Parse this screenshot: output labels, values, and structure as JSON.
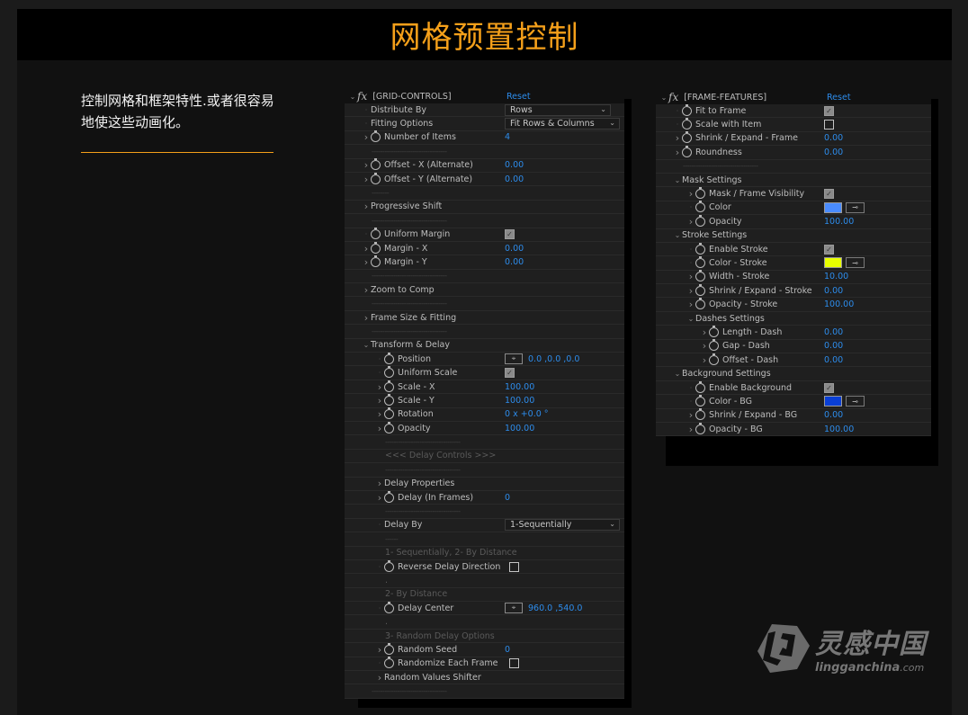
{
  "page": {
    "title": "网格预置控制",
    "description": "控制网格和框架特性.或者很容易地使这些动画化。"
  },
  "colors": {
    "accent": "#f5a01a",
    "value_blue": "#2d8ceb",
    "mask_color": "#4a8cff",
    "stroke_color": "#e8ff00",
    "bg_color": "#0a3fd6"
  },
  "grid_panel": {
    "title": "[GRID-CONTROLS]",
    "reset_label": "Reset",
    "rows": [
      {
        "type": "dropdown",
        "label": "Distribute By",
        "value": "Rows",
        "expander": "none",
        "stopwatch": false,
        "indent": 0
      },
      {
        "type": "dropdown",
        "label": "Fitting Options",
        "value": "Fit Rows & Columns",
        "expander": "none",
        "stopwatch": false,
        "indent": 0
      },
      {
        "type": "value",
        "label": "Number of Items",
        "value": "4",
        "expander": "collapsed",
        "stopwatch": true,
        "indent": 0
      },
      {
        "type": "separator",
        "label": "-----------------------------------",
        "indent": 0
      },
      {
        "type": "value",
        "label": "Offset - X (Alternate)",
        "value": "0.00",
        "expander": "collapsed",
        "stopwatch": true,
        "indent": 0
      },
      {
        "type": "value",
        "label": "Offset - Y (Alternate)",
        "value": "0.00",
        "expander": "collapsed",
        "stopwatch": true,
        "indent": 0
      },
      {
        "type": "separator",
        "label": "--------",
        "indent": 0
      },
      {
        "type": "group",
        "label": "Progressive Shift",
        "expander": "collapsed",
        "indent": 0
      },
      {
        "type": "separator",
        "label": "-----------------------------------",
        "indent": 0
      },
      {
        "type": "checkbox",
        "label": "Uniform Margin",
        "checked": true,
        "expander": "none",
        "stopwatch": true,
        "indent": 0
      },
      {
        "type": "value",
        "label": "Margin - X",
        "value": "0.00",
        "expander": "collapsed",
        "stopwatch": true,
        "indent": 0
      },
      {
        "type": "value",
        "label": "Margin - Y",
        "value": "0.00",
        "expander": "collapsed",
        "stopwatch": true,
        "indent": 0
      },
      {
        "type": "separator",
        "label": "-----------------------------------",
        "indent": 0
      },
      {
        "type": "group",
        "label": "Zoom to Comp",
        "expander": "collapsed",
        "indent": 0
      },
      {
        "type": "separator",
        "label": "-----------------------------------",
        "indent": 0
      },
      {
        "type": "group",
        "label": "Frame Size & Fitting",
        "expander": "collapsed",
        "indent": 0
      },
      {
        "type": "separator",
        "label": "-----------------------------------",
        "indent": 0
      },
      {
        "type": "group",
        "label": "Transform & Delay",
        "expander": "expanded",
        "indent": 0
      },
      {
        "type": "point",
        "label": "Position",
        "value": "0.0 ,0.0 ,0.0",
        "expander": "none",
        "stopwatch": true,
        "indent": 1
      },
      {
        "type": "checkbox",
        "label": "Uniform Scale",
        "checked": true,
        "expander": "none",
        "stopwatch": true,
        "indent": 1
      },
      {
        "type": "value",
        "label": "Scale - X",
        "value": "100.00",
        "expander": "collapsed",
        "stopwatch": true,
        "indent": 1
      },
      {
        "type": "value",
        "label": "Scale - Y",
        "value": "100.00",
        "expander": "collapsed",
        "stopwatch": true,
        "indent": 1
      },
      {
        "type": "value",
        "label": "Rotation",
        "value": "0 x +0.0 °",
        "expander": "collapsed",
        "stopwatch": true,
        "indent": 1
      },
      {
        "type": "value",
        "label": "Opacity",
        "value": "100.00",
        "expander": "collapsed",
        "stopwatch": true,
        "indent": 1
      },
      {
        "type": "separator",
        "label": "-----------------------------------",
        "indent": 1
      },
      {
        "type": "note",
        "label": "<<< Delay Controls >>>",
        "indent": 1
      },
      {
        "type": "separator",
        "label": "-----------------------------------",
        "indent": 1
      },
      {
        "type": "group",
        "label": "Delay Properties",
        "expander": "collapsed",
        "indent": 1
      },
      {
        "type": "value",
        "label": "Delay (In Frames)",
        "value": "0",
        "expander": "collapsed",
        "stopwatch": true,
        "indent": 1
      },
      {
        "type": "separator",
        "label": "-----------------------------------",
        "indent": 1
      },
      {
        "type": "dropdown",
        "label": "Delay By",
        "value": "1-Sequentially",
        "expander": "none",
        "stopwatch": false,
        "indent": 1
      },
      {
        "type": "separator",
        "label": "------",
        "indent": 1
      },
      {
        "type": "note",
        "label": "1- Sequentially, 2- By Distance",
        "indent": 1
      },
      {
        "type": "checkbox",
        "label": "Reverse Delay Direction",
        "checked": false,
        "expander": "none",
        "stopwatch": true,
        "indent": 1
      },
      {
        "type": "note",
        "label": ".",
        "indent": 1
      },
      {
        "type": "note",
        "label": "2- By Distance",
        "indent": 1
      },
      {
        "type": "point",
        "label": "Delay Center",
        "value": "960.0 ,540.0",
        "expander": "none",
        "stopwatch": true,
        "indent": 1
      },
      {
        "type": "note",
        "label": ".",
        "indent": 1
      },
      {
        "type": "note",
        "label": "3- Random Delay Options",
        "indent": 1
      },
      {
        "type": "value",
        "label": "Random Seed",
        "value": "0",
        "expander": "collapsed",
        "stopwatch": true,
        "indent": 1
      },
      {
        "type": "checkbox",
        "label": "Randomize Each Frame",
        "checked": false,
        "expander": "none",
        "stopwatch": true,
        "indent": 1
      },
      {
        "type": "group",
        "label": "Random Values Shifter",
        "expander": "collapsed",
        "indent": 1
      },
      {
        "type": "separator",
        "label": "-----------------------------------",
        "indent": 0
      }
    ]
  },
  "frame_panel": {
    "title": "[FRAME-FEATURES]",
    "reset_label": "Reset",
    "rows": [
      {
        "type": "checkbox",
        "label": "Fit to Frame",
        "checked": true,
        "expander": "none",
        "stopwatch": true,
        "indent": 0
      },
      {
        "type": "checkbox",
        "label": "Scale with Item",
        "checked": false,
        "expander": "none",
        "stopwatch": true,
        "indent": 0
      },
      {
        "type": "value",
        "label": "Shrink / Expand - Frame",
        "value": "0.00",
        "expander": "collapsed",
        "stopwatch": true,
        "indent": 0
      },
      {
        "type": "value",
        "label": "Roundness",
        "value": "0.00",
        "expander": "collapsed",
        "stopwatch": true,
        "indent": 0
      },
      {
        "type": "separator",
        "label": "-----------------------------------",
        "indent": 0
      },
      {
        "type": "group",
        "label": "Mask Settings",
        "expander": "expanded",
        "indent": 0
      },
      {
        "type": "checkbox",
        "label": "Mask / Frame Visibility",
        "checked": true,
        "expander": "collapsed",
        "stopwatch": true,
        "indent": 1
      },
      {
        "type": "color",
        "label": "Color",
        "color_key": "mask_color",
        "expander": "none",
        "stopwatch": true,
        "indent": 1
      },
      {
        "type": "value",
        "label": "Opacity",
        "value": "100.00",
        "expander": "collapsed",
        "stopwatch": true,
        "indent": 1
      },
      {
        "type": "group",
        "label": "Stroke Settings",
        "expander": "expanded",
        "indent": 0
      },
      {
        "type": "checkbox",
        "label": "Enable Stroke",
        "checked": true,
        "expander": "none",
        "stopwatch": true,
        "indent": 1
      },
      {
        "type": "color",
        "label": "Color - Stroke",
        "color_key": "stroke_color",
        "expander": "none",
        "stopwatch": true,
        "indent": 1
      },
      {
        "type": "value",
        "label": "Width - Stroke",
        "value": "10.00",
        "expander": "collapsed",
        "stopwatch": true,
        "indent": 1
      },
      {
        "type": "value",
        "label": "Shrink / Expand - Stroke",
        "value": "0.00",
        "expander": "collapsed",
        "stopwatch": true,
        "indent": 1
      },
      {
        "type": "value",
        "label": "Opacity - Stroke",
        "value": "100.00",
        "expander": "collapsed",
        "stopwatch": true,
        "indent": 1
      },
      {
        "type": "group",
        "label": "Dashes Settings",
        "expander": "expanded",
        "indent": 1
      },
      {
        "type": "value",
        "label": "Length - Dash",
        "value": "0.00",
        "expander": "collapsed",
        "stopwatch": true,
        "indent": 2
      },
      {
        "type": "value",
        "label": "Gap - Dash",
        "value": "0.00",
        "expander": "collapsed",
        "stopwatch": true,
        "indent": 2
      },
      {
        "type": "value",
        "label": "Offset - Dash",
        "value": "0.00",
        "expander": "collapsed",
        "stopwatch": true,
        "indent": 2
      },
      {
        "type": "group",
        "label": "Background Settings",
        "expander": "expanded",
        "indent": 0
      },
      {
        "type": "checkbox",
        "label": "Enable Background",
        "checked": true,
        "expander": "none",
        "stopwatch": true,
        "indent": 1
      },
      {
        "type": "color",
        "label": "Color - BG",
        "color_key": "bg_color",
        "expander": "none",
        "stopwatch": true,
        "indent": 1
      },
      {
        "type": "value",
        "label": "Shrink / Expand - BG",
        "value": "0.00",
        "expander": "collapsed",
        "stopwatch": true,
        "indent": 1
      },
      {
        "type": "value",
        "label": "Opacity - BG",
        "value": "100.00",
        "expander": "collapsed",
        "stopwatch": true,
        "indent": 1
      }
    ]
  },
  "watermark": {
    "cn": "灵感中国",
    "en_main": "lingganchina",
    "en_suffix": ".com",
    "logo_icon": "lg-hexagon-logo"
  }
}
